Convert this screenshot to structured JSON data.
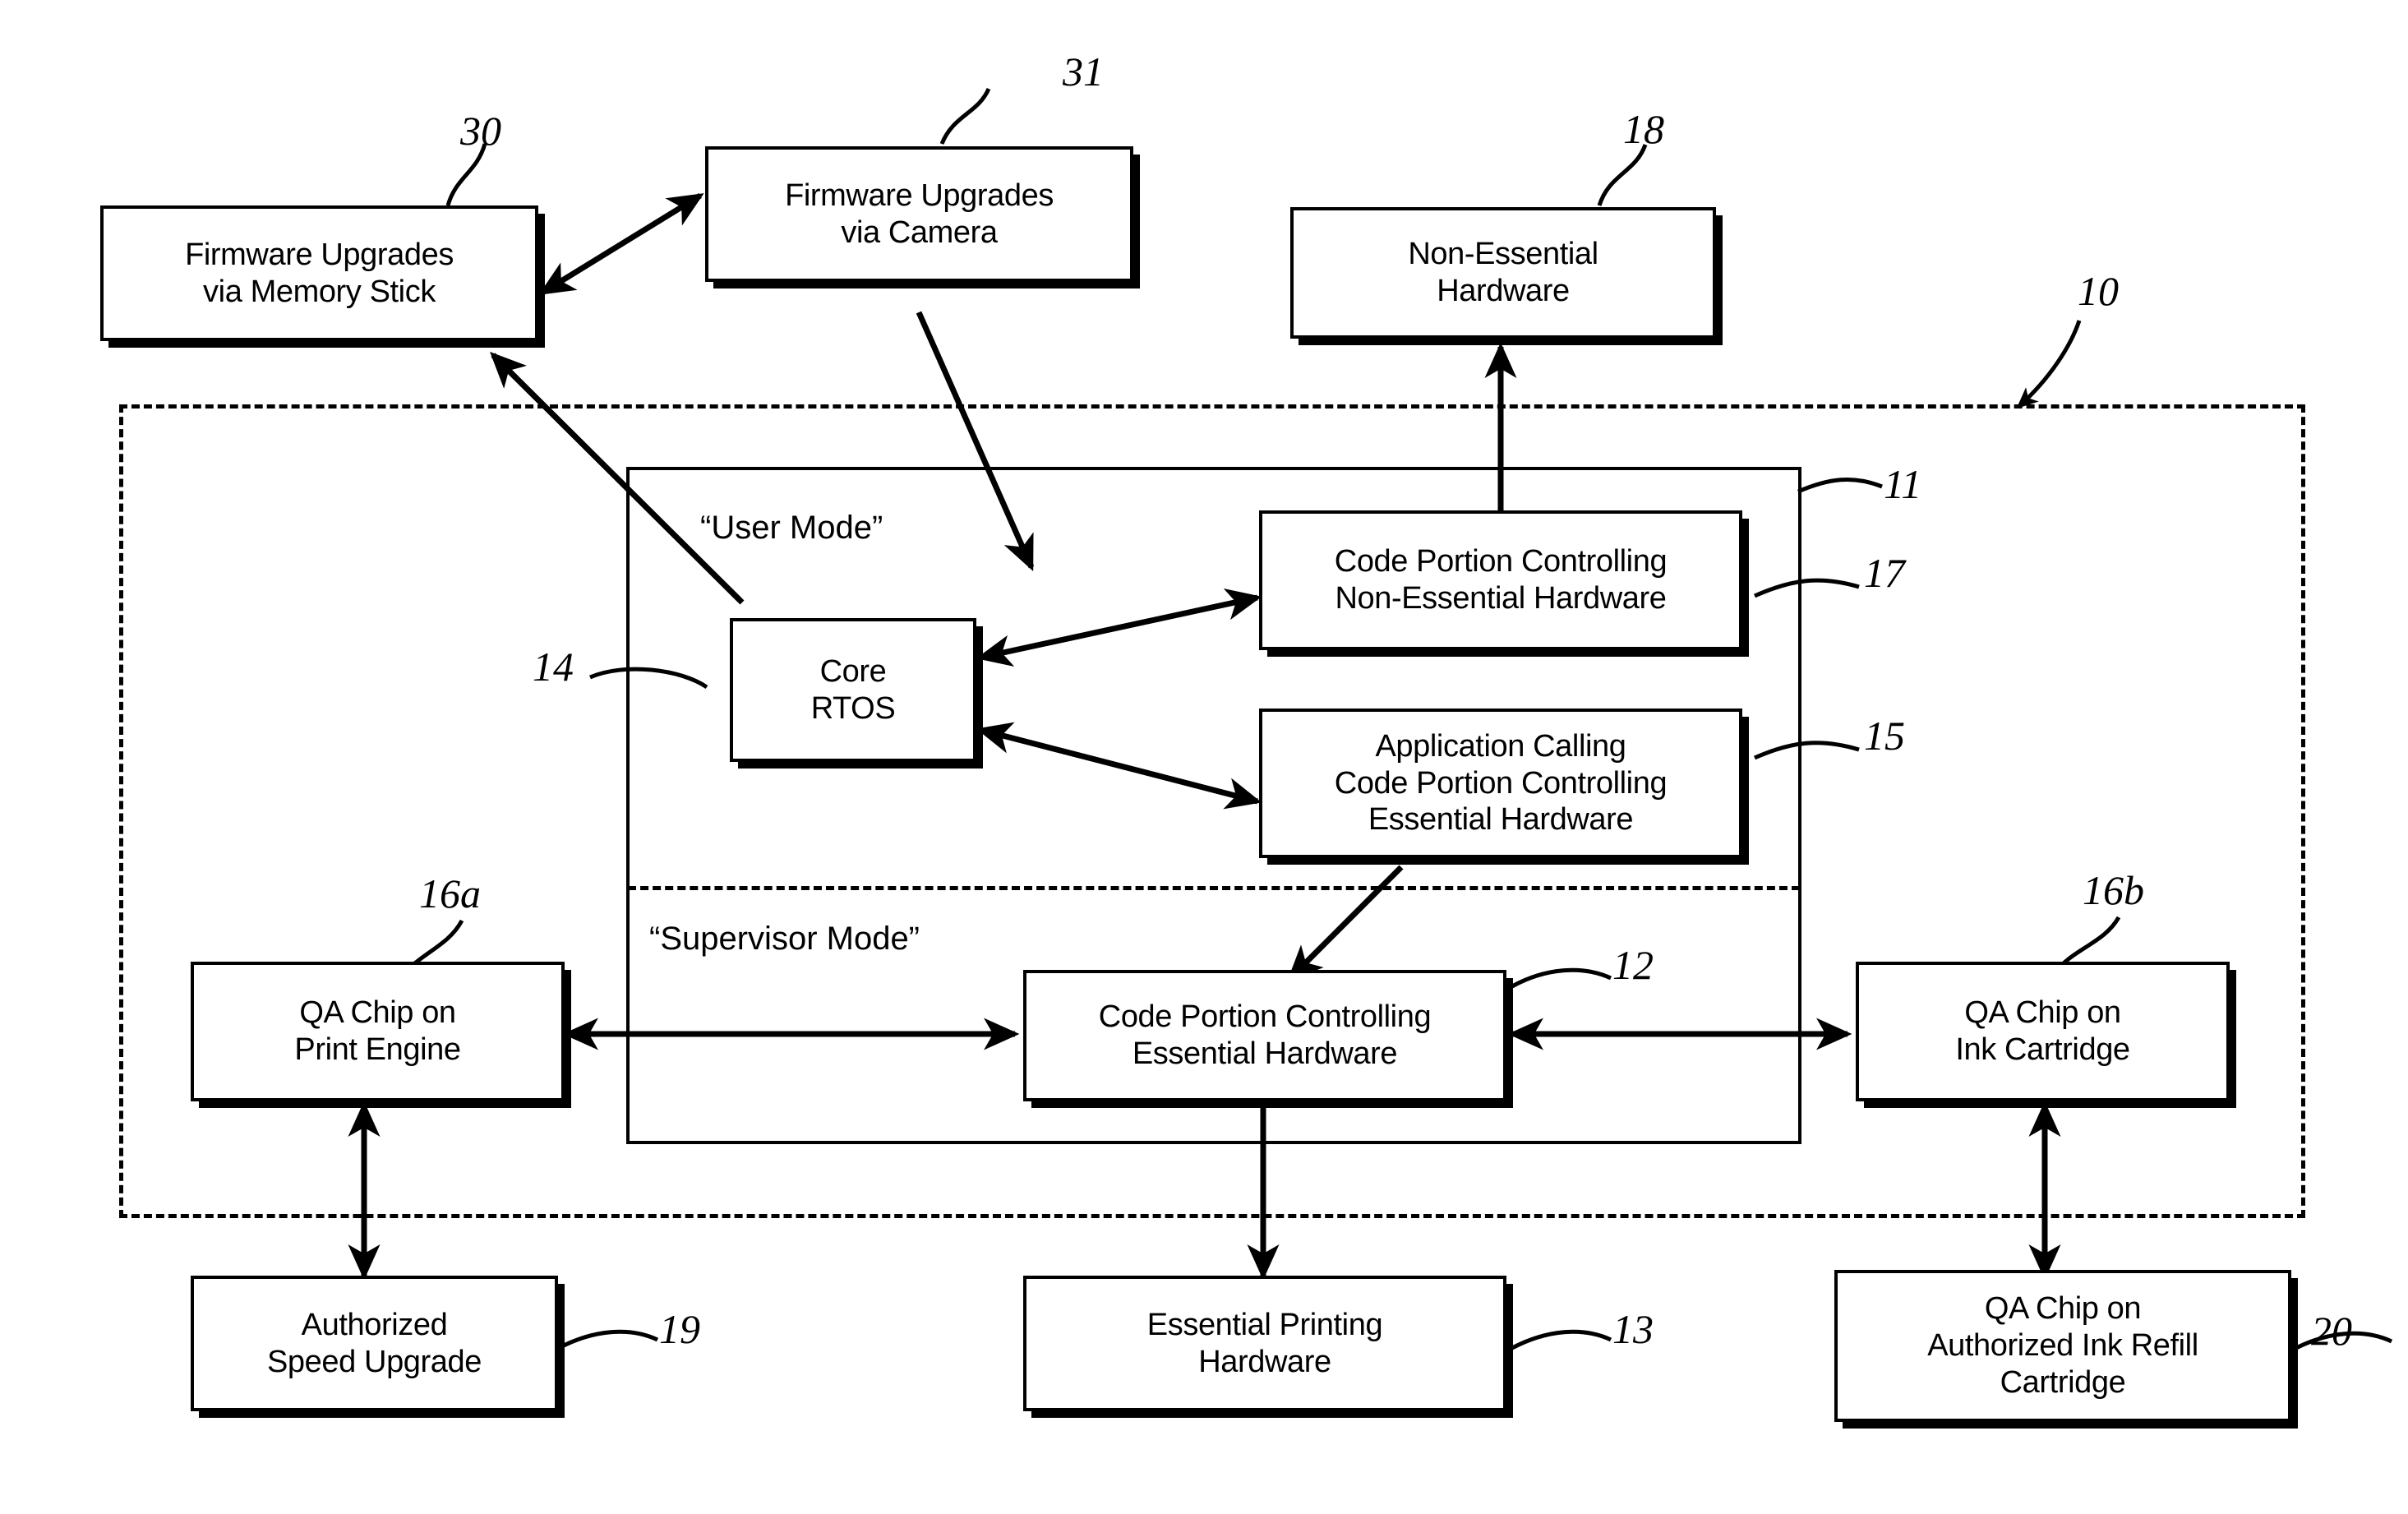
{
  "figure": {
    "type": "patent-block-diagram",
    "background_color": "#ffffff",
    "line_color": "#000000"
  },
  "containers": [
    {
      "id": "printer-system",
      "name": "printer-system-boundary",
      "style": "dashed",
      "ref": "10"
    },
    {
      "id": "processor",
      "name": "processor-boundary",
      "style": "solid",
      "ref": "11"
    }
  ],
  "mode_labels": {
    "user_mode": "“User Mode”",
    "supervisor_mode": "“Supervisor Mode”"
  },
  "nodes": [
    {
      "id": "fw_memstick",
      "label": "Firmware Upgrades\nvia Memory Stick",
      "ref": "30"
    },
    {
      "id": "fw_camera",
      "label": "Firmware Upgrades\nvia Camera",
      "ref": "31"
    },
    {
      "id": "non_ess_hw",
      "label": "Non-Essential\nHardware",
      "ref": "18"
    },
    {
      "id": "core_rtos",
      "label": "Core\nRTOS",
      "ref": "14"
    },
    {
      "id": "cp_non_ess",
      "label": "Code Portion Controlling\nNon-Essential Hardware",
      "ref": "17"
    },
    {
      "id": "app_calling",
      "label": "Application Calling\nCode Portion Controlling\nEssential Hardware",
      "ref": "15"
    },
    {
      "id": "qa_print_engine",
      "label": "QA Chip on\nPrint Engine",
      "ref": "16a"
    },
    {
      "id": "cp_essential",
      "label": "Code Portion Controlling\nEssential Hardware",
      "ref": "12"
    },
    {
      "id": "qa_ink_cart",
      "label": "QA Chip on\nInk Cartridge",
      "ref": "16b"
    },
    {
      "id": "auth_speed",
      "label": "Authorized\nSpeed Upgrade",
      "ref": "19"
    },
    {
      "id": "ess_print_hw",
      "label": "Essential Printing\nHardware",
      "ref": "13"
    },
    {
      "id": "qa_refill",
      "label": "QA Chip on\nAuthorized Ink Refill\nCartridge",
      "ref": "20"
    }
  ],
  "reference_numerals": {
    "n10": "10",
    "n11": "11",
    "n12": "12",
    "n13": "13",
    "n14": "14",
    "n15": "15",
    "n16a": "16a",
    "n16b": "16b",
    "n17": "17",
    "n18": "18",
    "n19": "19",
    "n20": "20",
    "n30": "30",
    "n31": "31"
  },
  "connections": [
    {
      "from": "fw_memstick",
      "to": "fw_camera",
      "arrow": "both"
    },
    {
      "from": "fw_camera",
      "to": "core_rtos",
      "arrow": "to"
    },
    {
      "from": "fw_memstick",
      "to": "core_rtos",
      "arrow": "both"
    },
    {
      "from": "cp_non_ess",
      "to": "non_ess_hw",
      "arrow": "to"
    },
    {
      "from": "cp_non_ess",
      "to": "core_rtos",
      "arrow": "both"
    },
    {
      "from": "app_calling",
      "to": "core_rtos",
      "arrow": "both"
    },
    {
      "from": "app_calling",
      "to": "cp_essential",
      "arrow": "to"
    },
    {
      "from": "cp_essential",
      "to": "qa_print_engine",
      "arrow": "both"
    },
    {
      "from": "cp_essential",
      "to": "qa_ink_cart",
      "arrow": "both"
    },
    {
      "from": "cp_essential",
      "to": "ess_print_hw",
      "arrow": "to"
    },
    {
      "from": "qa_print_engine",
      "to": "auth_speed",
      "arrow": "both"
    },
    {
      "from": "qa_ink_cart",
      "to": "qa_refill",
      "arrow": "both"
    }
  ]
}
